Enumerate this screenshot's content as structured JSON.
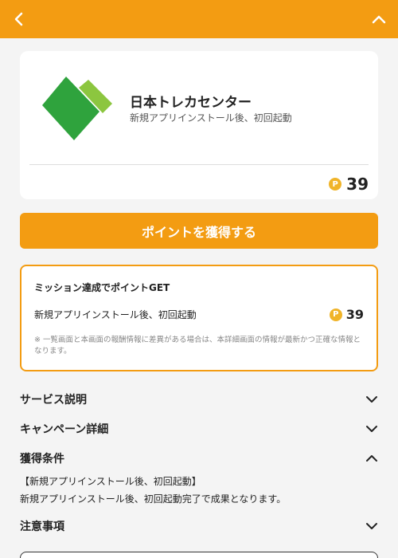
{
  "header": {
    "back_icon": "chevron-left-icon",
    "collapse_icon": "chevron-up-icon",
    "bg_color": "#f39c12"
  },
  "app": {
    "name": "日本トレカセンター",
    "subtitle": "新規アプリインストール後、初回起動",
    "logo_icon": "green-diamond-logo",
    "points": "39",
    "coin_symbol": "P"
  },
  "cta": {
    "label": "ポイントを獲得する"
  },
  "mission": {
    "title": "ミッション達成でポイントGET",
    "item_label": "新規アプリインストール後、初回起動",
    "item_points": "39",
    "note": "※ 一覧画面と本画面の報酬情報に差異がある場合は、本詳細画面の情報が最新かつ正確な情報となります。"
  },
  "sections": {
    "service": "サービス説明",
    "campaign": "キャンペーン詳細",
    "conditions": "獲得条件",
    "cautions": "注意事項"
  },
  "conditions": {
    "line1": "【新規アプリインストール後、初回起動】",
    "line2": "新規アプリインストール後、初回起動完了で成果となります。"
  },
  "colors": {
    "accent": "#f39c12",
    "coin": "#f0b429",
    "logo_dark": "#2fa33d",
    "logo_light": "#8cc63f"
  }
}
